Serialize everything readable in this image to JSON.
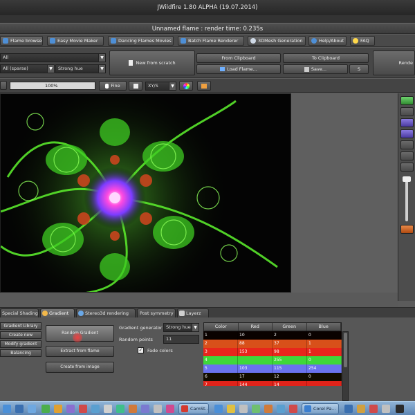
{
  "window": {
    "title": "JWildfire 1.80 ALPHA (19.07.2014)",
    "subtitle": "Unnamed flame : render time: 0.235s"
  },
  "menu": {
    "items": [
      {
        "label": "Flame browser",
        "icon": "folder-icon",
        "color": "#4e8fd6"
      },
      {
        "label": "Easy Movie Maker",
        "icon": "movie-icon",
        "color": "#4e8fd6"
      },
      {
        "label": "Dancing Flames Movies",
        "icon": "dance-icon",
        "color": "#4e8fd6"
      },
      {
        "label": "Batch Flame Renderer",
        "icon": "batch-icon",
        "color": "#4e8fd6"
      },
      {
        "label": "3DMesh Generation",
        "icon": "mesh-icon",
        "color": "#cfd9e6"
      },
      {
        "label": "Help/About",
        "icon": "help-icon",
        "color": "#4e8fd6"
      },
      {
        "label": "FAQ",
        "icon": "faq-icon",
        "color": "#ffd84a"
      }
    ]
  },
  "toolbar": {
    "combo1": "All",
    "combo2": "All (sparse)",
    "combo3": "Strong hue",
    "new_from_scratch": "New from scratch",
    "from_clipboard": "From Clipboard",
    "load_flame": "Load Flame...",
    "to_clipboard": "To Clipboard",
    "save": "Save...",
    "save_small": "S",
    "render": "Rende"
  },
  "zoomrow": {
    "zoom_value": "100%",
    "fine_label": "Fine",
    "axis_combo": "XY/S"
  },
  "tabs": [
    {
      "label": "Special Shading",
      "active": false
    },
    {
      "label": "Gradient",
      "active": true
    },
    {
      "label": "Stereo3d rendering",
      "active": false
    },
    {
      "label": "Post symmetry",
      "active": false
    },
    {
      "label": "Layerz",
      "active": false
    }
  ],
  "gradient_panel": {
    "left_buttons": [
      "Gradient Library",
      "Create new",
      "Modify gradient",
      "Balancing"
    ],
    "random_gradient": "Random Gradient",
    "extract_from_flame": "Extract from flame",
    "create_from_image": "Create from image",
    "generator_label": "Gradient generator",
    "generator_value": "Strong hue",
    "random_points_label": "Random points",
    "random_points_value": "11",
    "fade_colors_label": "Fade colors",
    "fade_colors_checked": true
  },
  "gradient_table": {
    "headers": [
      "Color",
      "Red",
      "Green",
      "Blue"
    ],
    "rows": [
      {
        "color": "1",
        "red": "10",
        "green": "2",
        "blue": "0",
        "bg": "#0a0200"
      },
      {
        "color": "2",
        "red": "88",
        "green": "37",
        "blue": "1",
        "bg": "#d8501a"
      },
      {
        "color": "3",
        "red": "153",
        "green": "98",
        "blue": "1",
        "bg": "#e8261c"
      },
      {
        "color": "4",
        "red": "",
        "green": "255",
        "blue": "0",
        "bg": "#3fd83a"
      },
      {
        "color": "5",
        "red": "103",
        "green": "115",
        "blue": "254",
        "bg": "#6a73ee"
      },
      {
        "color": "6",
        "red": "17",
        "green": "12",
        "blue": "0",
        "bg": "#110c00"
      },
      {
        "color": "7",
        "red": "144",
        "green": "14",
        "blue": "",
        "bg": "#e0231a"
      }
    ]
  },
  "taskbar": {
    "tasks": [
      {
        "label": "CamSt...",
        "color": "#d43a2f"
      },
      {
        "label": "Corel Pa...",
        "color": "#3b7fd0"
      }
    ]
  }
}
